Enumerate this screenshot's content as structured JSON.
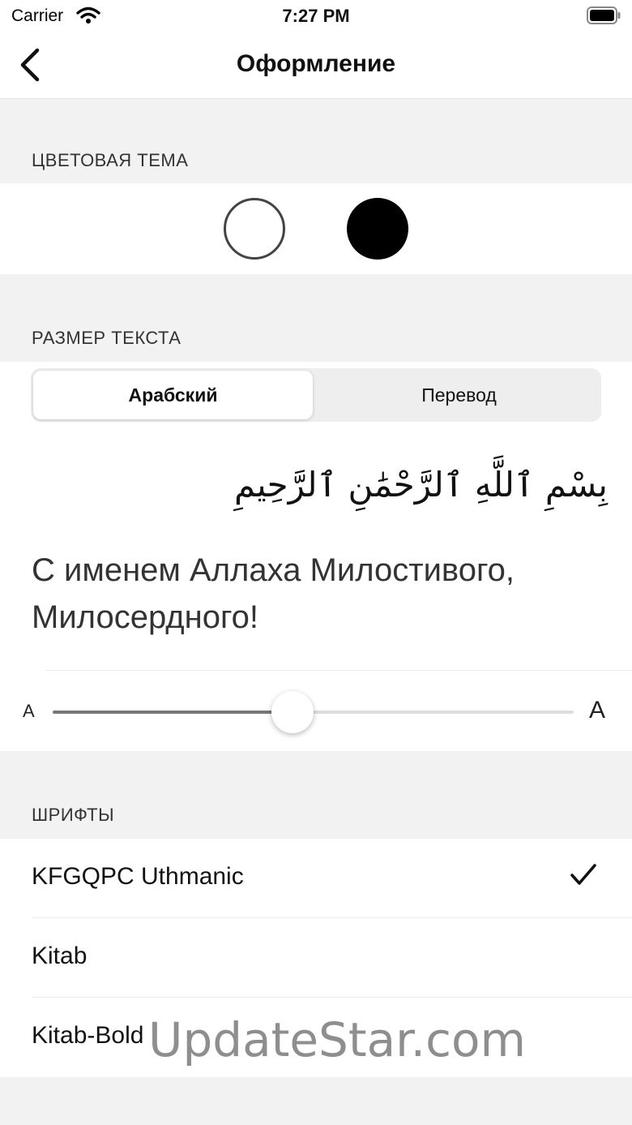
{
  "status_bar": {
    "carrier": "Carrier",
    "time": "7:27 PM",
    "icons": [
      "wifi-icon",
      "battery-icon"
    ]
  },
  "nav": {
    "title": "Оформление",
    "back_icon": "chevron-left-icon"
  },
  "color_theme": {
    "header": "ЦВЕТОВАЯ ТЕМА",
    "options": [
      "light",
      "dark"
    ],
    "colors": {
      "light": "#ffffff",
      "dark": "#000000"
    }
  },
  "text_size": {
    "header": "РАЗМЕР ТЕКСТА",
    "tabs": [
      {
        "label": "Арабский",
        "selected": true
      },
      {
        "label": "Перевод",
        "selected": false
      }
    ],
    "preview_arabic": "بِسْمِ ٱللَّهِ ٱلرَّحْمَٰنِ ٱلرَّحِيمِ",
    "preview_translation": "С именем Аллаха Милостивого, Милосердного!",
    "slider": {
      "min_label": "A",
      "max_label": "A",
      "value": 0.46
    }
  },
  "fonts": {
    "header": "ШРИФТЫ",
    "items": [
      {
        "label": "KFGQPC Uthmanic",
        "selected": true
      },
      {
        "label": "Kitab",
        "selected": false
      },
      {
        "label": "Kitab-Bold",
        "selected": false
      }
    ]
  },
  "watermark": "UpdateStar.com"
}
